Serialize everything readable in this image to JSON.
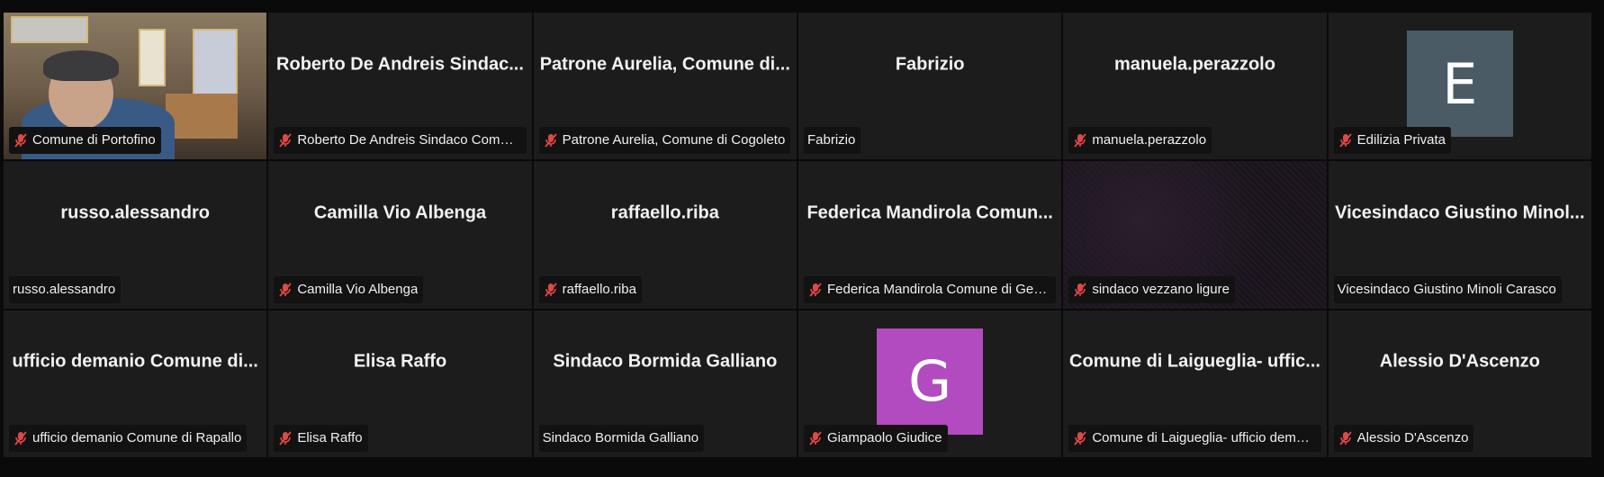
{
  "colors": {
    "background": "#0a0a0a",
    "tile": "#1c1c1c",
    "avatar_e": "#4a5b66",
    "avatar_g": "#b24bbf",
    "more_button": "#1f7ef0",
    "mic_muted": "#e04848"
  },
  "more_button": {
    "label": "..."
  },
  "tiles": [
    {
      "title": "",
      "namebar": "Comune di Portofino",
      "muted": true,
      "video": true
    },
    {
      "title": "Roberto De Andreis Sindac...",
      "namebar": "Roberto De Andreis Sindaco Comun...",
      "muted": true
    },
    {
      "title": "Patrone Aurelia, Comune di...",
      "namebar": "Patrone Aurelia, Comune di Cogoleto",
      "muted": true
    },
    {
      "title": "Fabrizio",
      "namebar": "Fabrizio",
      "muted": false
    },
    {
      "title": "manuela.perazzolo",
      "namebar": "manuela.perazzolo",
      "muted": true
    },
    {
      "title": "",
      "namebar": "Edilizia Privata",
      "muted": true,
      "avatar": "E"
    },
    {
      "title": "russo.alessandro",
      "namebar": "russo.alessandro",
      "muted": false
    },
    {
      "title": "Camilla Vio Albenga",
      "namebar": "Camilla Vio Albenga",
      "muted": true
    },
    {
      "title": "raffaello.riba",
      "namebar": "raffaello.riba",
      "muted": true
    },
    {
      "title": "Federica Mandirola Comun...",
      "namebar": "Federica Mandirola Comune di Geno...",
      "muted": true
    },
    {
      "title": "",
      "namebar": "sindaco vezzano ligure",
      "muted": true,
      "dark_video": true
    },
    {
      "title": "Vicesindaco Giustino Minol...",
      "namebar": "Vicesindaco Giustino Minoli Carasco",
      "muted": false
    },
    {
      "title": "ufficio demanio Comune di...",
      "namebar": "ufficio demanio Comune di Rapallo",
      "muted": true
    },
    {
      "title": "Elisa Raffo",
      "namebar": "Elisa Raffo",
      "muted": true
    },
    {
      "title": "Sindaco Bormida Galliano",
      "namebar": "Sindaco Bormida Galliano",
      "muted": false
    },
    {
      "title": "",
      "namebar": "Giampaolo Giudice",
      "muted": true,
      "avatar": "G"
    },
    {
      "title": "Comune di Laigueglia- uffic...",
      "namebar": "Comune di Laigueglia- ufficio deman...",
      "muted": true
    },
    {
      "title": "Alessio D'Ascenzo",
      "namebar": "Alessio D'Ascenzo",
      "muted": true
    }
  ]
}
